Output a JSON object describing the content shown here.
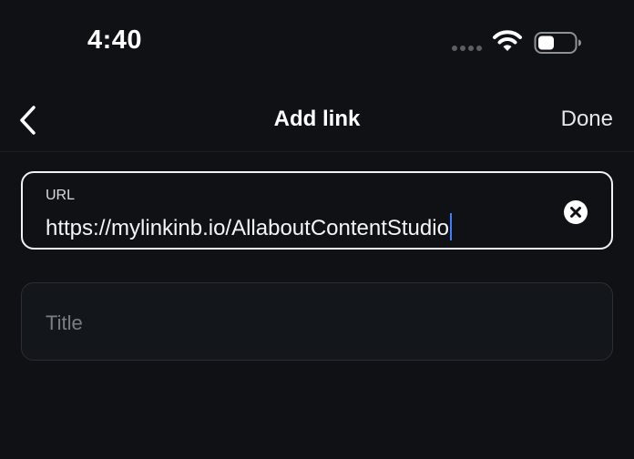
{
  "status_bar": {
    "time": "4:40"
  },
  "nav": {
    "title": "Add link",
    "done_label": "Done"
  },
  "url_field": {
    "label": "URL",
    "value": "https://mylinkinb.io/AllaboutContentStudio"
  },
  "title_field": {
    "placeholder": "Title",
    "value": ""
  },
  "colors": {
    "background": "#0f1115",
    "caret": "#3f7cff",
    "active_border": "#f1f2f4",
    "inactive_border": "#2b2e34"
  }
}
